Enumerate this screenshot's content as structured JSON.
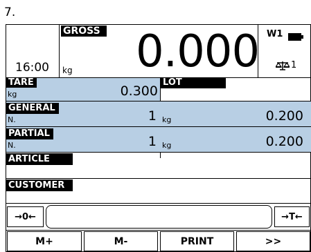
{
  "page_number": "7.",
  "header": {
    "time": "16:00",
    "gross_label": "GROSS",
    "unit": "kg",
    "main_value": "0.000",
    "scale_id": "W1",
    "scale_count": "1"
  },
  "tare": {
    "label": "TARE",
    "unit": "kg",
    "value": "0.300"
  },
  "lot": {
    "label": "LOT",
    "value": ""
  },
  "general": {
    "label": "GENERAL",
    "sub": "N.",
    "count": "1",
    "unit": "kg",
    "weight": "0.200"
  },
  "partial": {
    "label": "PARTIAL",
    "sub": "N.",
    "count": "1",
    "unit": "kg",
    "weight": "0.200"
  },
  "article": {
    "label": "ARTICLE"
  },
  "customer": {
    "label": "CUSTOMER"
  },
  "toolbar": {
    "zero_label": "→0←",
    "tare_label": "→T←",
    "input_value": ""
  },
  "softkeys": [
    "M+",
    "M-",
    "PRINT",
    ">>"
  ],
  "colors": {
    "field_bg": "#b8cfe4",
    "label_bg": "#000000"
  }
}
